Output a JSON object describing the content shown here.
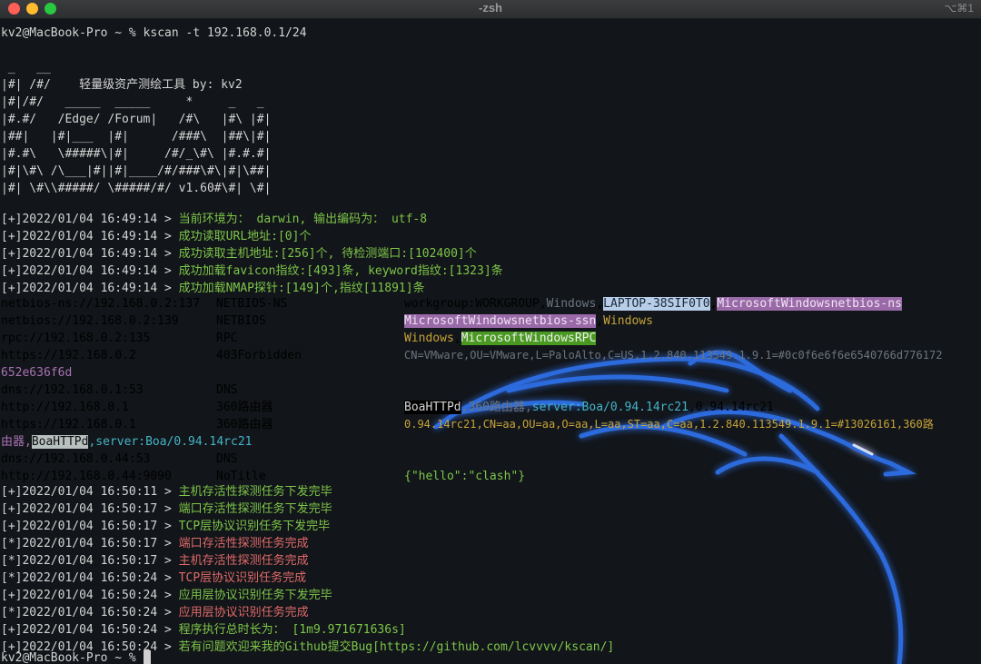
{
  "window": {
    "title": "-zsh",
    "shortcut": "⌥⌘1",
    "colors": {
      "background": "#121519",
      "green": "#7ec64a",
      "red": "#e06a6a",
      "purple": "#a872b4",
      "cyan": "#44b4c8",
      "dragon": "#3a7cf0"
    }
  },
  "command": {
    "prompt": "kv2@MacBook-Pro ~ % ",
    "text": "kscan -t 192.168.0.1/24"
  },
  "banner": [
    " _   __",
    "|#| /#/    轻量级资产测绘工具 by: kv2",
    "|#|/#/   _____  _____     *     _   _",
    "|#.#/   /Edge/ /Forum|   /#\\   |#\\ |#|",
    "|##|   |#|___  |#|      /###\\  |##\\|#|",
    "|#.#\\   \\#####\\|#|     /#/_\\#\\ |#.#.#|",
    "|#|\\#\\ /\\___|#||#|____/#/###\\#\\|#|\\##|",
    "|#| \\#\\\\#####/ \\#####/#/ v1.60#\\#| \\#|"
  ],
  "init_logs": [
    {
      "prefix": "[+]2022/01/04 16:49:14 > ",
      "msg": "当前环境为： darwin, 输出编码为： utf-8"
    },
    {
      "prefix": "[+]2022/01/04 16:49:14 > ",
      "msg": "成功读取URL地址:[0]个"
    },
    {
      "prefix": "[+]2022/01/04 16:49:14 > ",
      "msg": "成功读取主机地址:[256]个, 待检测端口:[102400]个"
    },
    {
      "prefix": "[+]2022/01/04 16:49:14 > ",
      "msg": "成功加载favicon指纹:[493]条, keyword指纹:[1323]条"
    },
    {
      "prefix": "[+]2022/01/04 16:49:14 > ",
      "msg": "成功加载NMAP探针:[149]个,指纹[11891]条"
    }
  ],
  "results": {
    "netbios_ns": {
      "url": "netbios-ns://192.168.0.2:137",
      "name": "NETBIOS-NS",
      "info_a": "workgroup:WORKGROUP,",
      "info_b": "Windows",
      "info_c": ",",
      "hl1": "LAPTOP-38SIF0T0",
      "info_d": ",",
      "hl2": "MicrosoftWindowsnetbios-ns"
    },
    "netbios": {
      "url": "netbios://192.168.0.2:139",
      "name": "NETBIOS",
      "hl1": "MicrosoftWindowsnetbios-ssn",
      "info_a": ",",
      "info_b": "Windows"
    },
    "rpc": {
      "url": "rpc://192.168.0.2:135",
      "name": "RPC",
      "info_a": "Windows",
      "info_b": ",",
      "hl1": "MicrosoftWindowsRPC"
    },
    "https2": {
      "url": "https://192.168.0.2",
      "name": "403Forbidden",
      "info_a": "CN=VMware,OU=VMware,L=PaloAlto,C=US,1.2.840.113549.1.9.1=#0c0f6e6f6e6540766d776172",
      "info_b": "652e636f6d"
    },
    "dns1": {
      "url": "dns://192.168.0.1:53",
      "name": "DNS"
    },
    "http1": {
      "url": "http://192.168.0.1",
      "name": "360路由器",
      "hl1": "BoaHTTPd",
      "info_a": ",360路由器,",
      "info_b": "server:Boa/0.94.14rc21",
      "info_c": ",0.94.14rc21"
    },
    "https1": {
      "url": "https://192.168.0.1",
      "name": "360路由器",
      "info_a": "0.94.14rc21,CN=aa,OU=aa,O=aa,L=aa,ST=aa,C=aa,1.2.840.113549.1.9.1=#13026161,360路",
      "info_b": "由器,",
      "hl1": "BoaHTTPd",
      "info_c": ",server:Boa/0.94.14rc21"
    },
    "dns44": {
      "url": "dns://192.168.0.44:53",
      "name": "DNS"
    },
    "http44": {
      "url": "http://192.168.0.44:9090",
      "name": "NoTitle",
      "info_a": "{\"hello\":\"clash\"}"
    }
  },
  "final_logs": [
    {
      "prefix": "[+]2022/01/04 16:50:11 > ",
      "msg": "主机存活性探测任务下发完毕"
    },
    {
      "prefix": "[+]2022/01/04 16:50:17 > ",
      "msg": "端口存活性探测任务下发完毕"
    },
    {
      "prefix": "[+]2022/01/04 16:50:17 > ",
      "msg": "TCP层协议识别任务下发完毕"
    },
    {
      "prefix": "[*]2022/01/04 16:50:17 > ",
      "msg": "端口存活性探测任务完成"
    },
    {
      "prefix": "[*]2022/01/04 16:50:17 > ",
      "msg": "主机存活性探测任务完成"
    },
    {
      "prefix": "[*]2022/01/04 16:50:24 > ",
      "msg": "TCP层协议识别任务完成"
    },
    {
      "prefix": "[+]2022/01/04 16:50:24 > ",
      "msg": "应用层协议识别任务下发完毕"
    },
    {
      "prefix": "[*]2022/01/04 16:50:24 > ",
      "msg": "应用层协议识别任务完成"
    },
    {
      "prefix": "[+]2022/01/04 16:50:24 > ",
      "msg": "程序执行总时长为： [1m9.971671636s]"
    },
    {
      "prefix": "[+]2022/01/04 16:50:24 > ",
      "msg": "若有问题欢迎来我的Github提交Bug[https://github.com/lcvvvv/kscan/]"
    }
  ],
  "final_prompt": "kv2@MacBook-Pro ~ % "
}
